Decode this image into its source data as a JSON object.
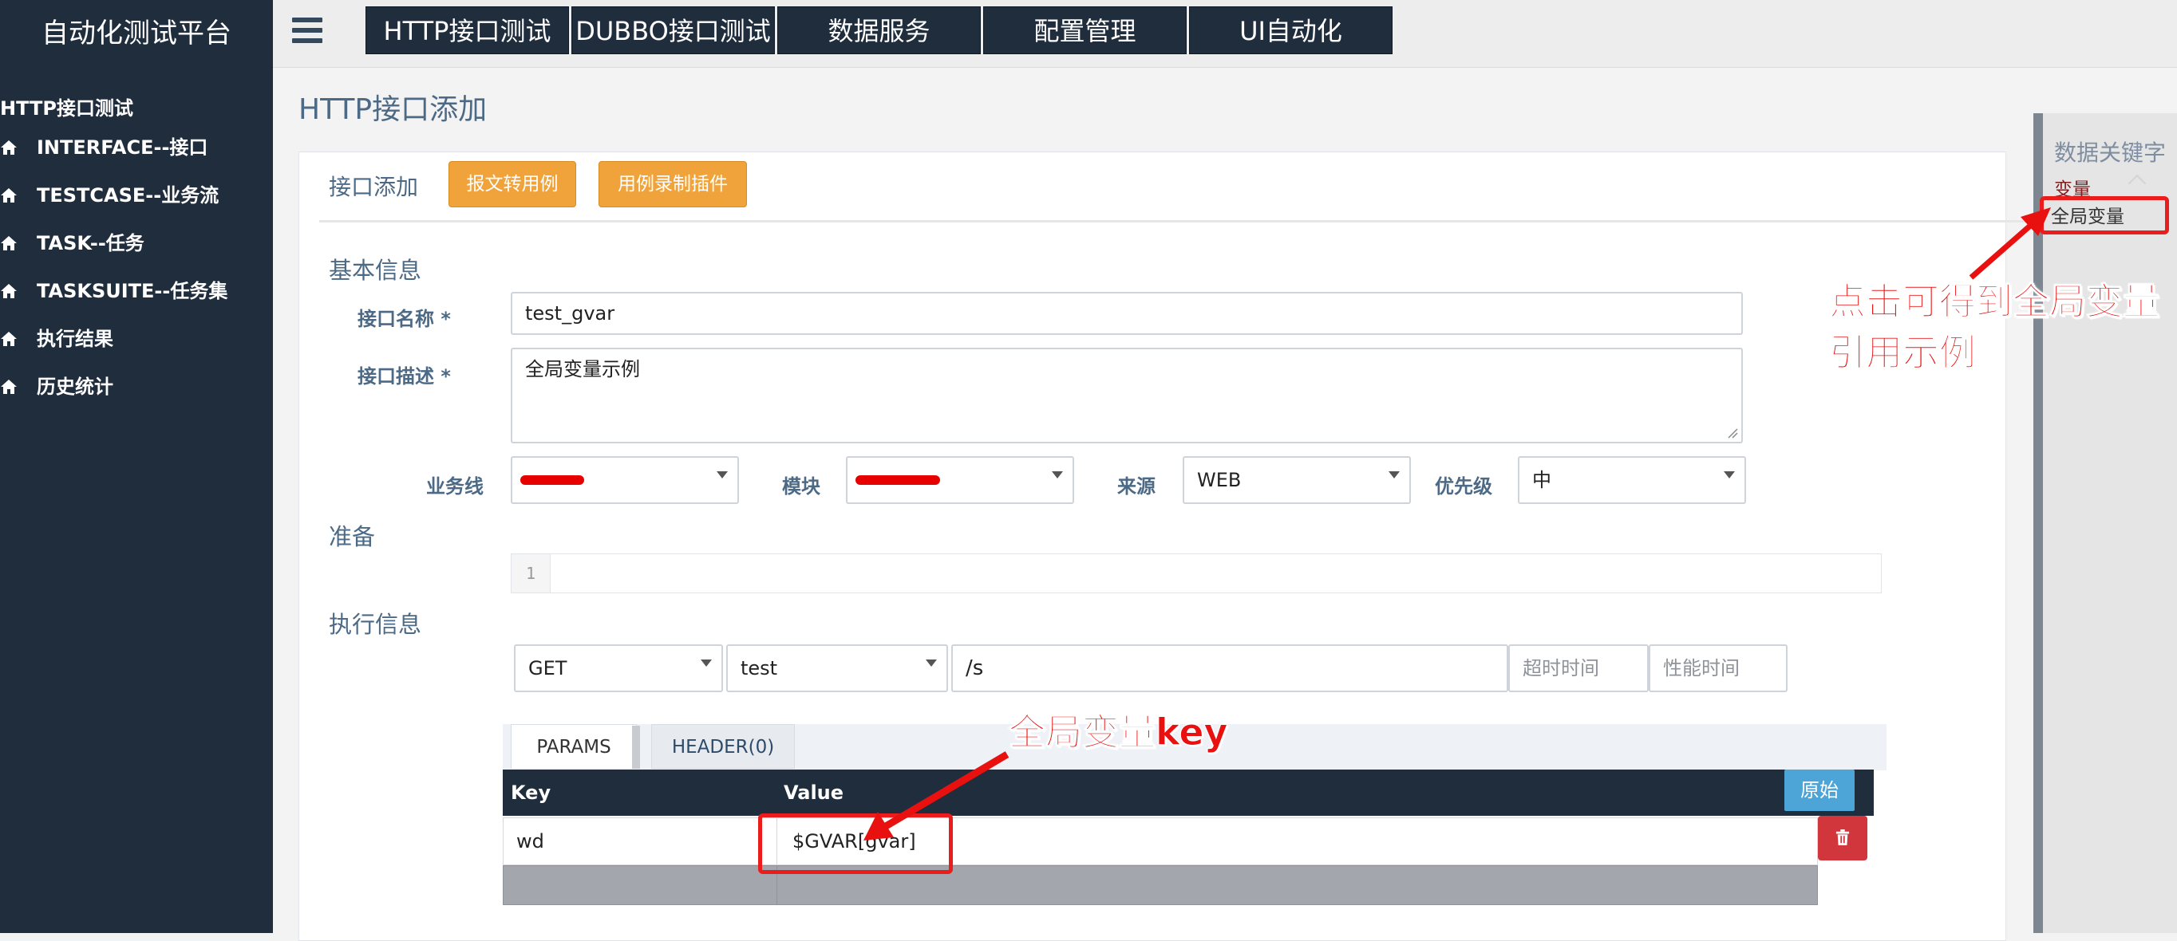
{
  "app": {
    "brand": "自动化测试平台"
  },
  "topnav": [
    "HTTP接口测试",
    "DUBBO接口测试",
    "数据服务",
    "配置管理",
    "UI自动化"
  ],
  "sidebar": {
    "section": "HTTP接口测试",
    "items": [
      "INTERFACE--接口",
      "TESTCASE--业务流",
      "TASK--任务",
      "TASKSUITE--任务集",
      "执行结果",
      "历史统计"
    ]
  },
  "page": {
    "title": "HTTP接口添加"
  },
  "panel": {
    "head_label": "接口添加",
    "btn_convert": "报文转用例",
    "btn_record": "用例录制插件"
  },
  "basic": {
    "section": "基本信息",
    "name_label": "接口名称 *",
    "name_value": "test_gvar",
    "desc_label": "接口描述 *",
    "desc_value": "全局变量示例",
    "biz_label": "业务线",
    "module_label": "模块",
    "source_label": "来源",
    "source_value": "WEB",
    "priority_label": "优先级",
    "priority_value": "中"
  },
  "prepare": {
    "section": "准备",
    "line_no": "1"
  },
  "exec": {
    "section": "执行信息",
    "method": "GET",
    "env": "test",
    "path": "/s",
    "timeout_placeholder": "超时时间",
    "perf_placeholder": "性能时间"
  },
  "tabs": {
    "params": "PARAMS",
    "header": "HEADER(0)"
  },
  "params_table": {
    "headers": [
      "Key",
      "Value"
    ],
    "raw_button": "原始",
    "rows": [
      {
        "key": "wd",
        "value": "$GVAR[gvar]"
      }
    ]
  },
  "keywords": {
    "title": "数据关键字",
    "var_group": "变量",
    "global_var": "全局变量"
  },
  "annotations": {
    "gvar_key": "全局变量key",
    "click_tip_line1": "点击可得到全局变量",
    "click_tip_line2": "引用示例"
  },
  "colors": {
    "sidebar_bg": "#1f2d3d",
    "accent_orange": "#f0a33a",
    "annotation_red": "#e8110f",
    "delete_red": "#d0363b",
    "raw_blue": "#4da4d6"
  }
}
